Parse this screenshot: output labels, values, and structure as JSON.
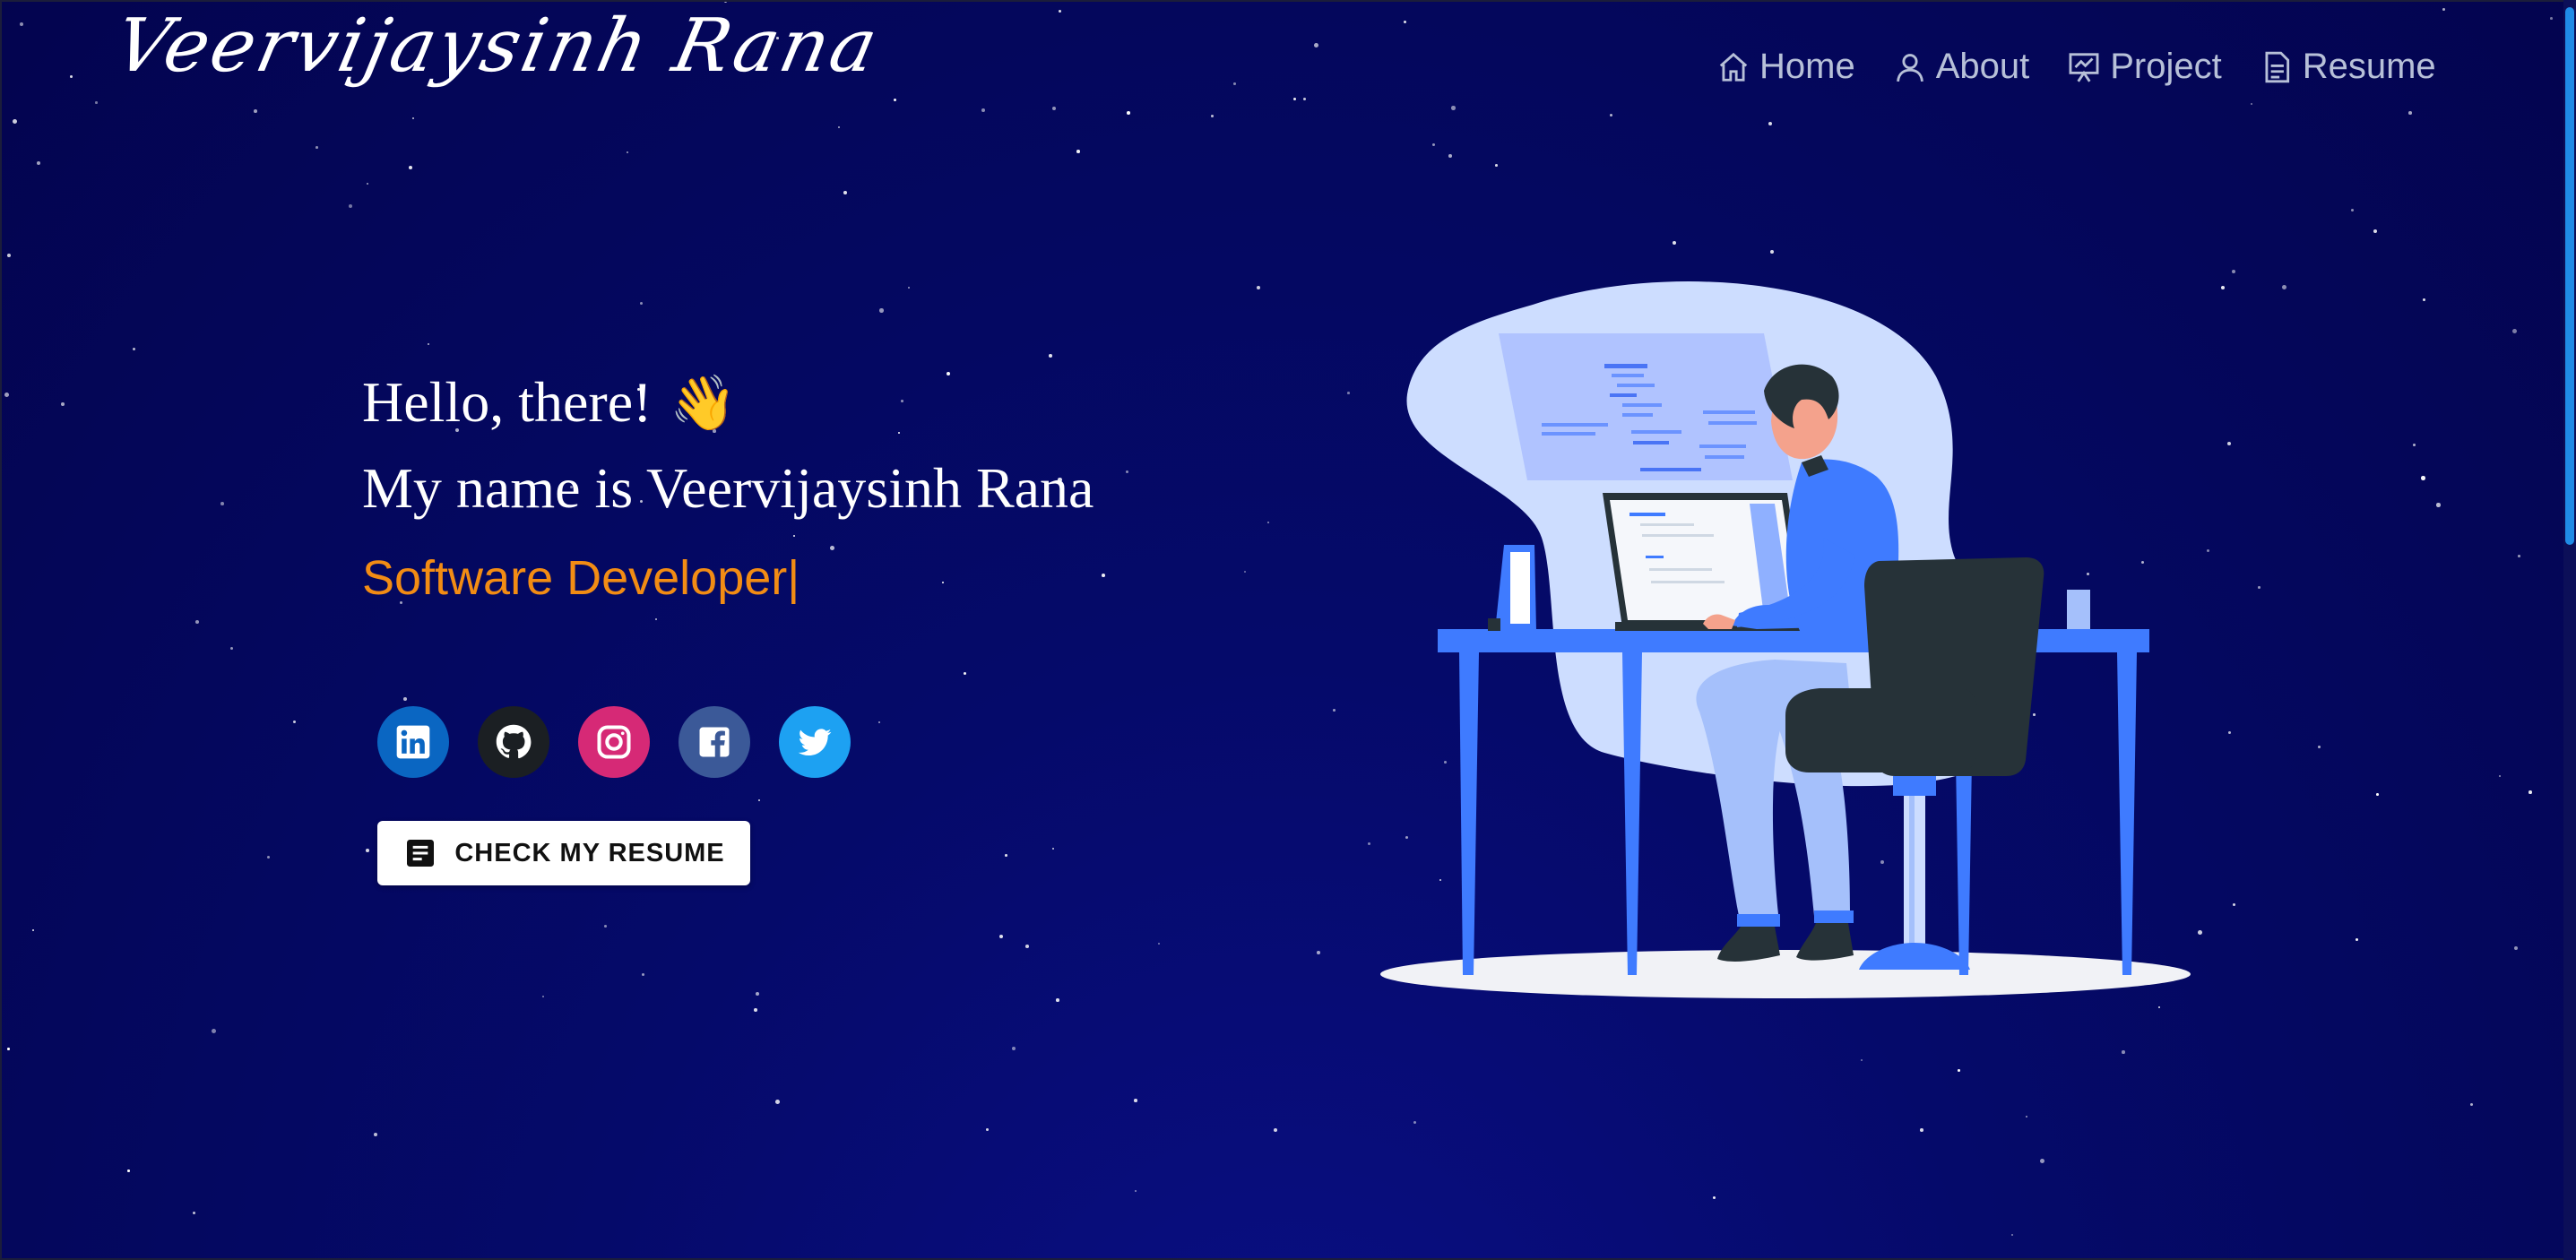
{
  "brand": {
    "logo_text": "Veervijaysinh Rana"
  },
  "nav": {
    "items": [
      {
        "label": "Home",
        "icon": "home-icon"
      },
      {
        "label": "About",
        "icon": "user-icon"
      },
      {
        "label": "Project",
        "icon": "presentation-icon"
      },
      {
        "label": "Resume",
        "icon": "document-icon"
      }
    ]
  },
  "hero": {
    "greeting": "Hello, there!",
    "wave_emoji": "👋",
    "name_line": "My name is Veervijaysinh Rana",
    "role": "Software Developer",
    "cursor": "|"
  },
  "socials": [
    {
      "name": "linkedin",
      "icon": "linkedin-icon",
      "color": "#0a66c2"
    },
    {
      "name": "github",
      "icon": "github-icon",
      "color": "#1b1f23"
    },
    {
      "name": "instagram",
      "icon": "instagram-icon",
      "color": "#d62976"
    },
    {
      "name": "facebook",
      "icon": "facebook-icon",
      "color": "#3b5998"
    },
    {
      "name": "twitter",
      "icon": "twitter-icon",
      "color": "#1da1f2"
    }
  ],
  "cta": {
    "resume_label": "CHECK MY RESUME",
    "icon": "document-icon"
  },
  "colors": {
    "accent": "#f28c14",
    "background": "#050a6a",
    "nav_text": "#b7c0d8"
  }
}
